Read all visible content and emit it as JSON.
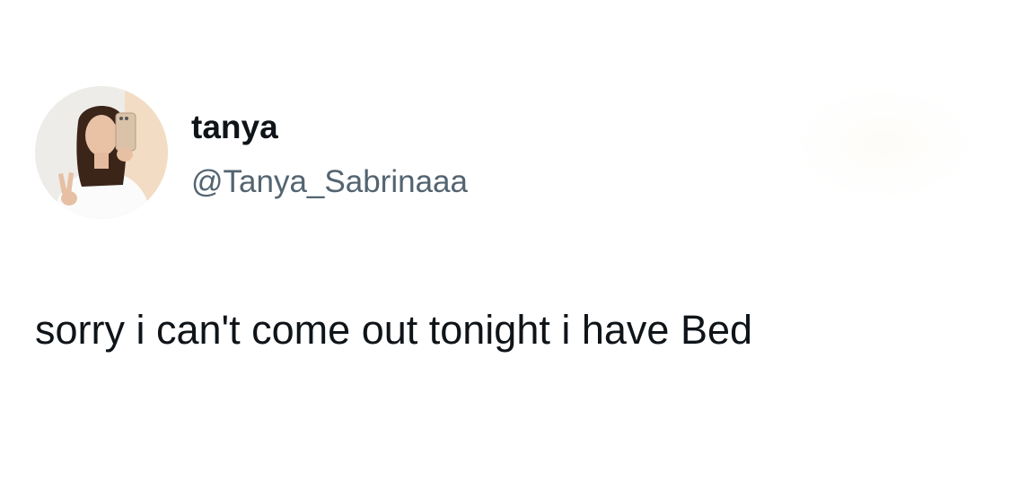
{
  "tweet": {
    "display_name": "tanya",
    "handle": "@Tanya_Sabrinaaa",
    "text": "sorry i can't come out tonight i have Bed"
  },
  "avatar": {
    "icon": "profile-photo-avatar"
  },
  "colors": {
    "name_text": "#0f1419",
    "handle_text": "#536471",
    "body_text": "#0f1419",
    "background": "#ffffff"
  }
}
